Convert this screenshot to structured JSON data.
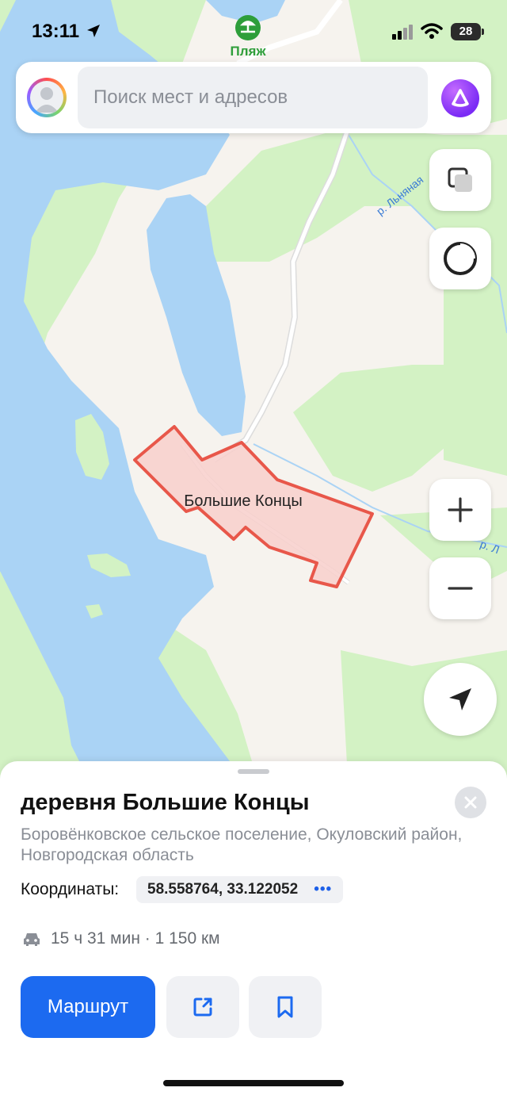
{
  "status_bar": {
    "time": "13:11",
    "battery": "28"
  },
  "map": {
    "poi_label": "Пляж",
    "river_label_1": "р. Льняная",
    "river_label_2": "р. Л",
    "settlement_label": "Большие Концы",
    "colors": {
      "water": "#aad3f5",
      "forest": "#d3f2c4",
      "land": "#f6f3ee",
      "polygon_fill": "#f8cfcb",
      "polygon_stroke": "#e8574a",
      "poi": "#2e9e3a"
    }
  },
  "search": {
    "placeholder": "Поиск мест и адресов",
    "avatar_icon": "user-avatar-icon",
    "assistant_icon": "alice-assistant-icon"
  },
  "map_controls": {
    "layers_icon": "layers-icon",
    "compass_icon": "compass-icon",
    "zoom_in_icon": "plus-icon",
    "zoom_out_icon": "minus-icon",
    "locate_icon": "location-arrow-icon"
  },
  "place_card": {
    "title": "деревня Большие Концы",
    "address": "Боровёнковское сельское поселение, Окуловский район, Новгородская область",
    "coords_label": "Координаты:",
    "coords_value": "58.558764, 33.122052",
    "coords_more": "•••",
    "route_time": "15 ч 31 мин · 1 150 км",
    "route_button": "Маршрут",
    "accent": "#1c6af0"
  }
}
